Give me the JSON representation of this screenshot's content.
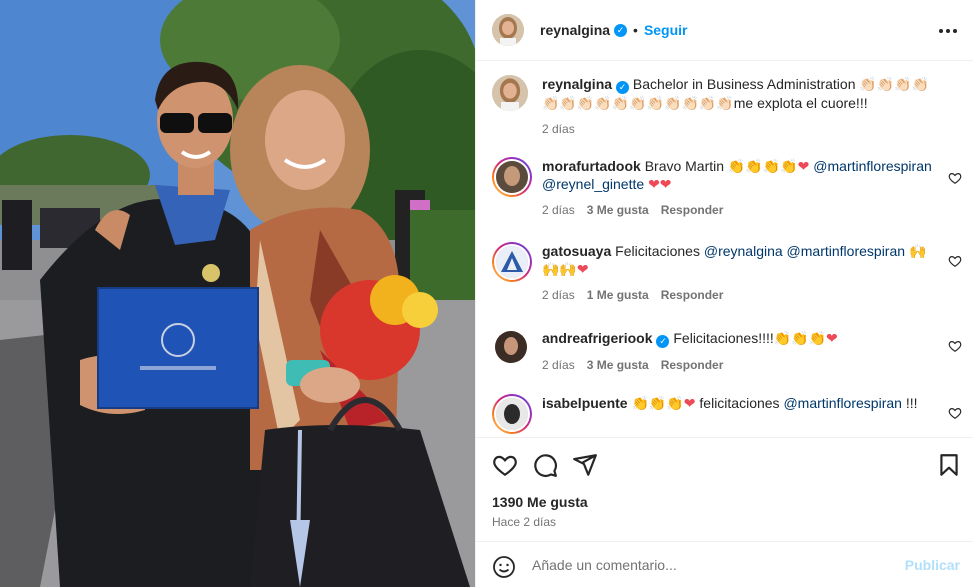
{
  "post": {
    "author": "reynalgina",
    "follow_label": "Seguir",
    "separator": "•",
    "verified_mark": "✓"
  },
  "caption": {
    "username": "reynalgina",
    "text": "Bachelor in Business Administration 👏🏻👏🏻👏🏻👏🏻 👏🏻👏🏻👏🏻👏🏻👏🏻👏🏻👏🏻👏🏻👏🏻👏🏻👏🏻me explota el cuore!!!",
    "time": "2 días"
  },
  "comments": [
    {
      "username": "morafurtadook",
      "text_before": "Bravo Martin 👏👏👏👏",
      "heart_a": "❤",
      "mentions": "@martinflorespiran @reynel_ginette",
      "heart_b": "❤❤",
      "time": "2 días",
      "likes": "3 Me gusta",
      "reply": "Responder"
    },
    {
      "username": "gatosuaya",
      "text_before": "Felicitaciones",
      "mentions": "@reynalgina @martinflorespiran",
      "text_after": "🙌🙌🙌",
      "heart_a": "❤",
      "time": "2 días",
      "likes": "1 Me gusta",
      "reply": "Responder"
    },
    {
      "username": "andreafrigeriook",
      "text_before": "Felicitaciones!!!!👏👏👏",
      "heart_a": "❤",
      "time": "2 días",
      "likes": "3 Me gusta",
      "reply": "Responder"
    },
    {
      "username": "isabelpuente",
      "text_before": "👏👏👏",
      "heart_a": "❤",
      "text_mid": "felicitaciones",
      "mentions": "@martinflorespiran",
      "text_after": "!!!"
    }
  ],
  "actions": {
    "like_icon": "heart-outline-icon",
    "comment_icon": "comment-bubble-icon",
    "share_icon": "paper-plane-icon",
    "save_icon": "bookmark-icon"
  },
  "stats": {
    "likes": "1390 Me gusta",
    "ago": "Hace 2 días"
  },
  "composer": {
    "placeholder": "Añade un comentario...",
    "publish_label": "Publicar"
  },
  "colors": {
    "accent": "#0095f6",
    "mention": "#00376b",
    "heart": "#ed4956",
    "meta": "#737373",
    "publish_disabled": "#b2dffc"
  }
}
